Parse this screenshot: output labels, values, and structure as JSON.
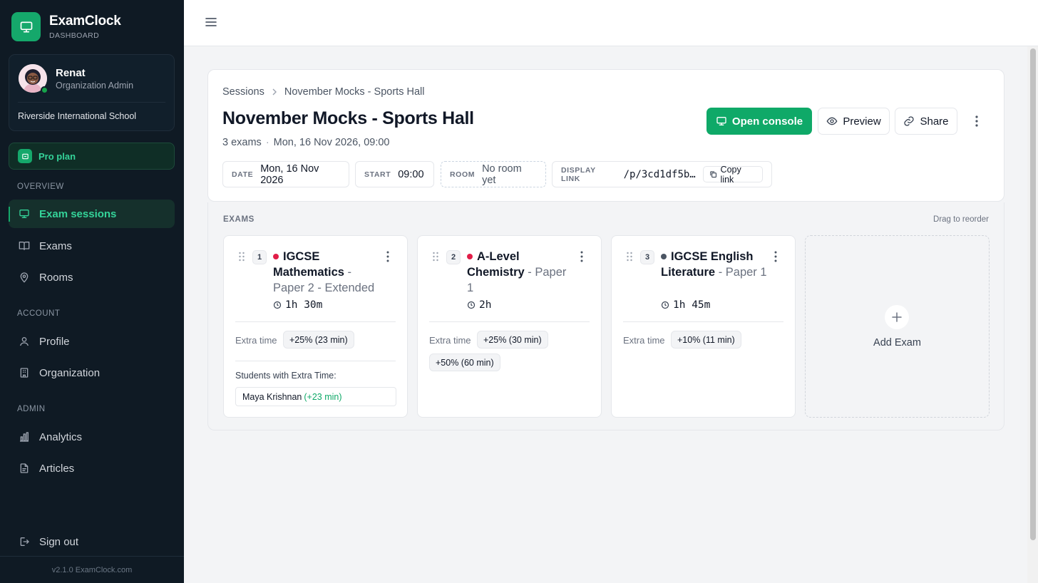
{
  "brand": {
    "name": "ExamClock",
    "sub": "DASHBOARD"
  },
  "user": {
    "name": "Renat",
    "role": "Organization Admin",
    "org": "Riverside International School"
  },
  "plan": {
    "label": "Pro plan"
  },
  "nav": {
    "overview_label": "OVERVIEW",
    "account_label": "ACCOUNT",
    "admin_label": "ADMIN",
    "items": [
      {
        "label": "Exam sessions",
        "icon": "monitor-icon"
      },
      {
        "label": "Exams",
        "icon": "book-icon"
      },
      {
        "label": "Rooms",
        "icon": "map-pin-icon"
      },
      {
        "label": "Profile",
        "icon": "user-icon"
      },
      {
        "label": "Organization",
        "icon": "building-icon"
      },
      {
        "label": "Analytics",
        "icon": "bar-chart-icon"
      },
      {
        "label": "Articles",
        "icon": "file-text-icon"
      }
    ],
    "signout": "Sign out",
    "version": "v2.1.0 ExamClock.com"
  },
  "breadcrumb": {
    "root": "Sessions",
    "current": "November Mocks - Sports Hall"
  },
  "session": {
    "title": "November Mocks - Sports Hall",
    "exam_count": "3 exams",
    "datetime": "Mon, 16 Nov 2026, 09:00"
  },
  "actions": {
    "open_console": "Open console",
    "preview": "Preview",
    "share": "Share"
  },
  "chips": {
    "date_label": "DATE",
    "date_value": "Mon, 16 Nov 2026",
    "start_label": "START",
    "start_value": "09:00",
    "room_label": "ROOM",
    "room_value": "No room yet",
    "link_label": "DISPLAY LINK",
    "link_value": "/p/3cd1df5b…",
    "copy_label": "Copy link"
  },
  "exams_panel": {
    "label": "EXAMS",
    "hint": "Drag to reorder",
    "add_label": "Add Exam"
  },
  "exams": [
    {
      "num": "1",
      "name": "IGCSE Mathematics",
      "paper": " - Paper 2 - Extended",
      "duration": "1h 30m",
      "status_color": "#e11d48",
      "extra_label": "Extra time",
      "pills": [
        "+25% (23 min)"
      ],
      "students_label": "Students with Extra Time:",
      "student_name": "Maya Krishnan",
      "student_extra": "(+23 min)"
    },
    {
      "num": "2",
      "name": "A-Level Chemistry",
      "paper": " - Paper 1",
      "duration": "2h",
      "status_color": "#e11d48",
      "extra_label": "Extra time",
      "pills": [
        "+25% (30 min)",
        "+50% (60 min)"
      ]
    },
    {
      "num": "3",
      "name": "IGCSE English Literature",
      "paper": " - Paper 1",
      "duration": "1h 45m",
      "status_color": "#4b5563",
      "extra_label": "Extra time",
      "pills": [
        "+10% (11 min)"
      ]
    }
  ],
  "colors": {
    "accent": "#0fa968",
    "sidebar_bg": "#0f1a24",
    "active_text": "#34d399"
  }
}
